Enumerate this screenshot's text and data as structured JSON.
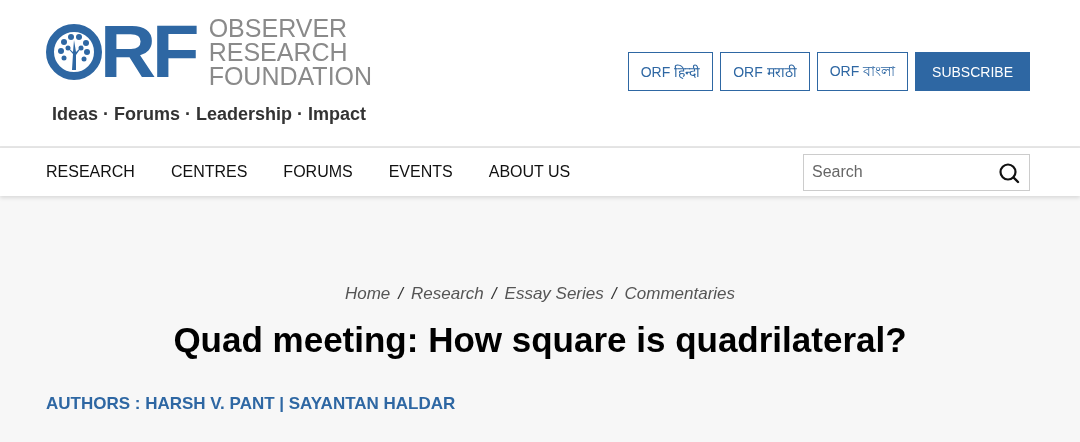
{
  "logo": {
    "letters": "RF",
    "name_lines": [
      "OBSERVER",
      "RESEARCH",
      "FOUNDATION"
    ],
    "tagline": "Ideas · Forums · Leadership · Impact"
  },
  "header_buttons": [
    {
      "label": "ORF हिन्दी",
      "kind": "outline"
    },
    {
      "label": "ORF मराठी",
      "kind": "outline"
    },
    {
      "label": "ORF বাংলা",
      "kind": "outline"
    },
    {
      "label": "SUBSCRIBE",
      "kind": "filled"
    }
  ],
  "nav": {
    "items": [
      "RESEARCH",
      "CENTRES",
      "FORUMS",
      "EVENTS",
      "ABOUT US"
    ],
    "search": {
      "placeholder": "Search"
    }
  },
  "breadcrumb": {
    "items": [
      "Home",
      "Research",
      "Essay Series",
      "Commentaries"
    ],
    "separator": "/"
  },
  "title": "Quad meeting: How square is quadrilateral?",
  "authors": "AUTHORS : HARSH V. PANT | SAYANTAN HALDAR"
}
